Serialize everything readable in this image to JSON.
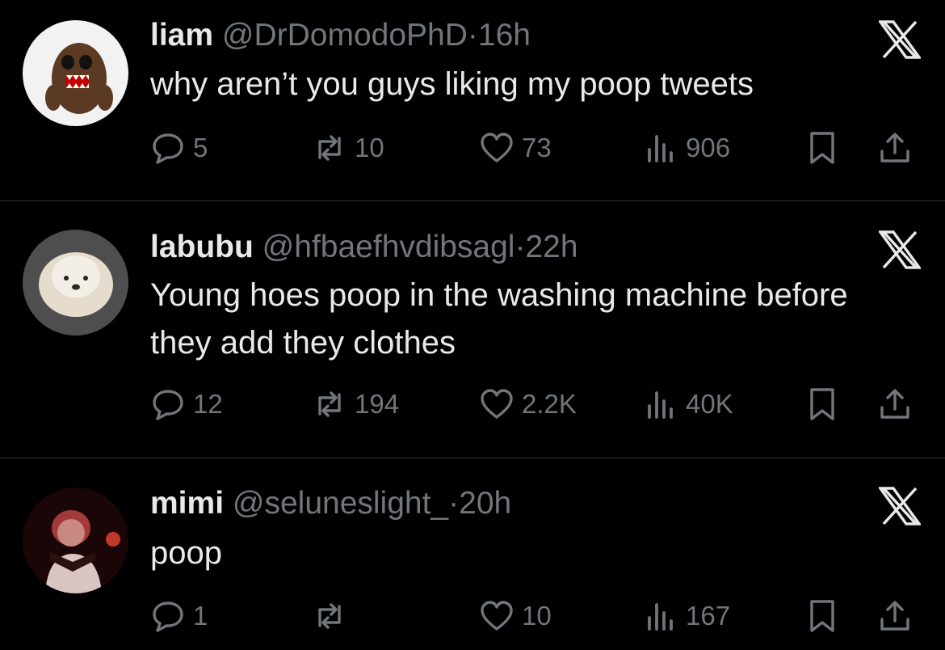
{
  "tweets": [
    {
      "name": "liam",
      "handle": "@DrDomodoPhD",
      "time": "16h",
      "text": "why aren’t you guys liking my poop tweets",
      "replies": "5",
      "reposts": "10",
      "likes": "73",
      "views": "906"
    },
    {
      "name": "labubu",
      "handle": "@hfbaefhvdibsagl",
      "time": "22h",
      "text": "Young hoes poop in the washing machine before they add they clothes",
      "replies": "12",
      "reposts": "194",
      "likes": "2.2K",
      "views": "40K"
    },
    {
      "name": "mimi",
      "handle": "@seluneslight_",
      "time": "20h",
      "text": "poop",
      "replies": "1",
      "reposts": "",
      "likes": "10",
      "views": "167"
    }
  ],
  "separator": "·",
  "icons": {
    "platform": "x-logo-icon",
    "reply": "speech-bubble-icon",
    "repost": "repost-arrows-icon",
    "like": "heart-icon",
    "views": "bar-chart-icon",
    "bookmark": "bookmark-icon",
    "share": "share-upload-icon"
  },
  "colors": {
    "background": "#000000",
    "text_primary": "#e7e9ea",
    "text_secondary": "#71767b",
    "divider": "#2f3336"
  }
}
